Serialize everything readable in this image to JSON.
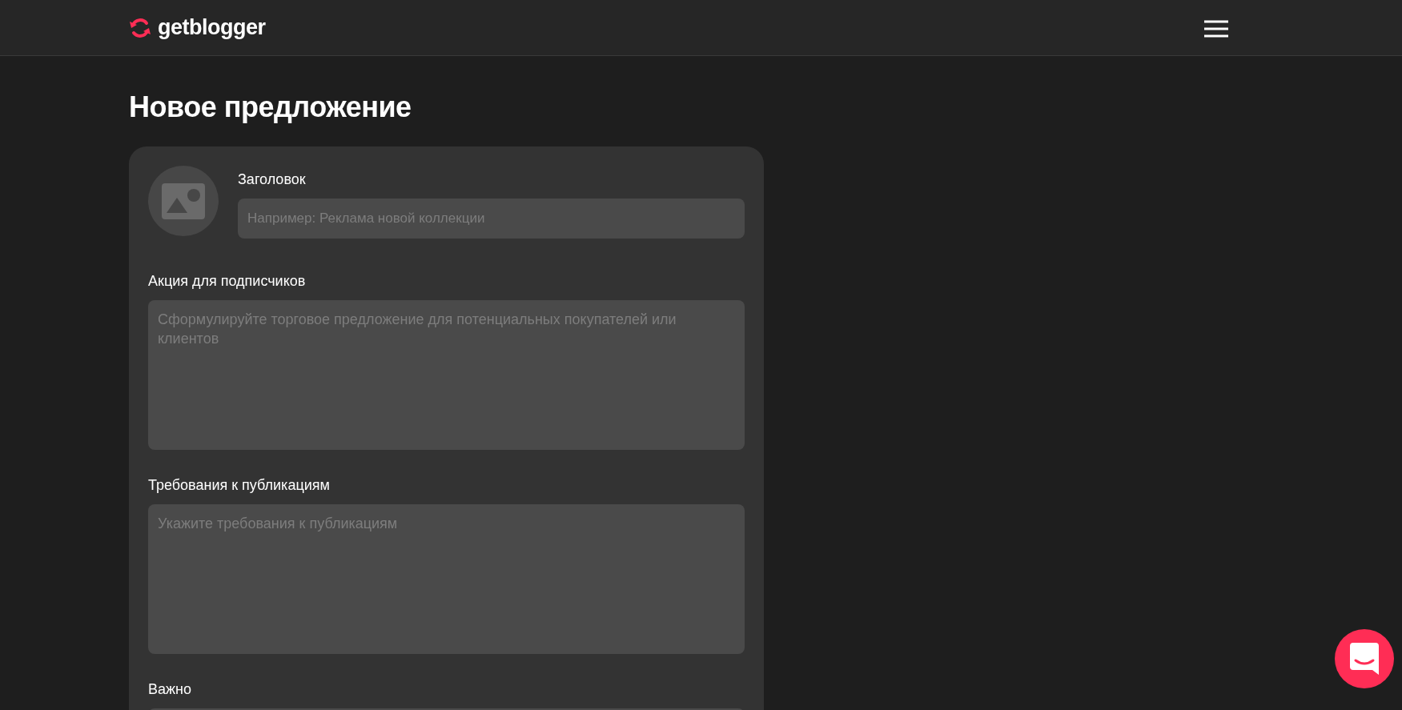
{
  "header": {
    "logo": "getblogger"
  },
  "page_title": "Новое предложение",
  "form": {
    "title_field": {
      "label": "Заголовок",
      "placeholder": "Например: Реклама новой коллекции"
    },
    "fields": [
      {
        "label": "Акция для подписчиков",
        "placeholder": "Сформулируйте торговое предложение для потенциальных покупателей или клиентов"
      },
      {
        "label": "Требования к публикациям",
        "placeholder": "Укажите требования к публикациям"
      },
      {
        "label": "Важно"
      }
    ]
  }
}
